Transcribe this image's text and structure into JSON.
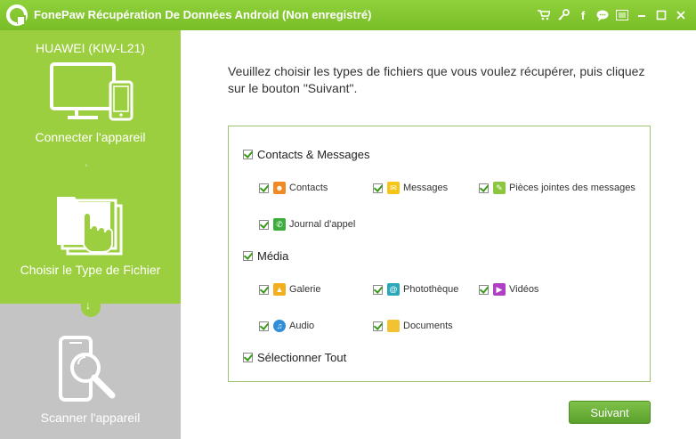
{
  "window": {
    "title": "FonePaw Récupération De Données Android (Non enregistré)",
    "icons": [
      "cart-icon",
      "key-icon",
      "facebook-icon",
      "chat-icon",
      "list-icon",
      "minimize-icon",
      "maximize-icon",
      "close-icon"
    ]
  },
  "sidebar": {
    "device_name": "HUAWEI (KIW-L21)",
    "steps": [
      {
        "label": "Connecter l'appareil",
        "state": "done"
      },
      {
        "label": "Choisir le Type de Fichier",
        "state": "active"
      },
      {
        "label": "Scanner l'appareil",
        "state": "pending"
      }
    ],
    "arrow": "↓"
  },
  "instruction": "Veuillez choisir les types de fichiers que vous voulez récupérer, puis cliquez sur le bouton \"Suivant\".",
  "groups": {
    "contacts_messages": {
      "label": "Contacts & Messages",
      "checked": true,
      "items": [
        {
          "label": "Contacts",
          "icon": "contacts-icon",
          "color": "#f08a24",
          "checked": true
        },
        {
          "label": "Messages",
          "icon": "messages-icon",
          "color": "#f5c518",
          "checked": true
        },
        {
          "label": "Pièces jointes des messages",
          "icon": "attachment-icon",
          "color": "#8cc63f",
          "checked": true
        },
        {
          "label": "Journal d'appel",
          "icon": "call-log-icon",
          "color": "#3dae3d",
          "checked": true
        }
      ]
    },
    "media": {
      "label": "Média",
      "checked": true,
      "items": [
        {
          "label": "Galerie",
          "icon": "gallery-icon",
          "color": "#f2b01e",
          "checked": true
        },
        {
          "label": "Photothèque",
          "icon": "photo-library-icon",
          "color": "#2aa7b8",
          "checked": true
        },
        {
          "label": "Vidéos",
          "icon": "videos-icon",
          "color": "#b03fc4",
          "checked": true
        },
        {
          "label": "Audio",
          "icon": "audio-icon",
          "color": "#2f8fd8",
          "checked": true
        },
        {
          "label": "Documents",
          "icon": "documents-icon",
          "color": "#f2c232",
          "checked": true
        }
      ]
    },
    "select_all": {
      "label": "Sélectionner Tout",
      "checked": true
    }
  },
  "next_button": "Suivant",
  "colors": {
    "accent": "#9ccf3f",
    "titlebar": "#85c832",
    "button": "#6bb03a",
    "inactive_step": "#c4c4c4"
  }
}
